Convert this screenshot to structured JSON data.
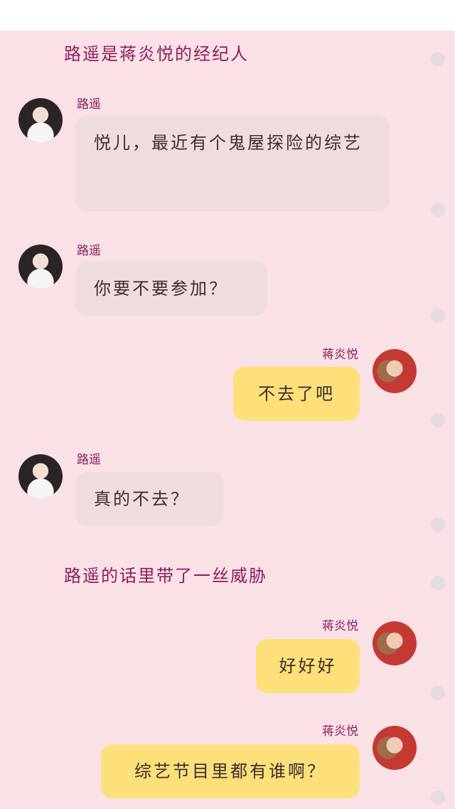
{
  "messages": {
    "narration1": "路遥是蒋炎悦的经纪人",
    "msg1": {
      "name": "路遥",
      "text": "悦儿，最近有个鬼屋探险的综艺"
    },
    "msg2": {
      "name": "路遥",
      "text": "你要不要参加？"
    },
    "msg3": {
      "name": "蒋炎悦",
      "text": "不去了吧"
    },
    "msg4": {
      "name": "路遥",
      "text": "真的不去？"
    },
    "narration2": "路遥的话里带了一丝威胁",
    "msg5": {
      "name": "蒋炎悦",
      "text": "好好好"
    },
    "msg6": {
      "name": "蒋炎悦",
      "text": "综艺节目里都有谁啊？"
    }
  },
  "colors": {
    "background": "#f9e1e6",
    "left_bubble": "#efdcdd",
    "right_bubble": "#fde07a",
    "name_text": "#8b1d5e"
  }
}
